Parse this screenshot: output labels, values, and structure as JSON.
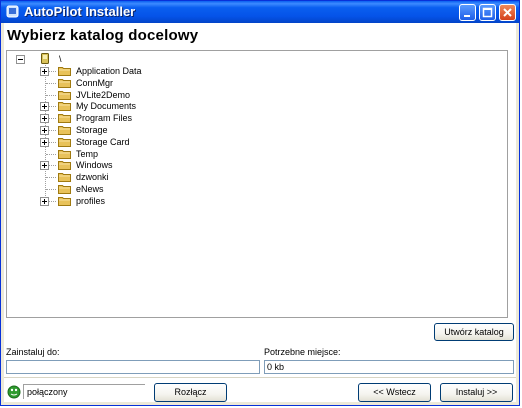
{
  "window": {
    "title": "AutoPilot Installer"
  },
  "heading": "Wybierz katalog docelowy",
  "tree": {
    "root": "\\",
    "items": [
      {
        "label": "Application Data",
        "expandable": true
      },
      {
        "label": "ConnMgr",
        "expandable": false
      },
      {
        "label": "JVLite2Demo",
        "expandable": false
      },
      {
        "label": "My Documents",
        "expandable": true
      },
      {
        "label": "Program Files",
        "expandable": true
      },
      {
        "label": "Storage",
        "expandable": true
      },
      {
        "label": "Storage Card",
        "expandable": true
      },
      {
        "label": "Temp",
        "expandable": false
      },
      {
        "label": "Windows",
        "expandable": true
      },
      {
        "label": "dzwonki",
        "expandable": false
      },
      {
        "label": "eNews",
        "expandable": false
      },
      {
        "label": "profiles",
        "expandable": true
      }
    ]
  },
  "buttons": {
    "create_folder": "Utwórz katalog",
    "disconnect": "Rozłącz",
    "back": "<< Wstecz",
    "install": "Instaluj >>"
  },
  "install_to": {
    "label": "Zainstaluj do:",
    "value": ""
  },
  "required_space": {
    "label": "Potrzebne miejsce:",
    "value": "0 kb"
  },
  "status": {
    "text": "połączony",
    "color": "#2e9b2e"
  },
  "colors": {
    "titlebar": "#0a5ff0",
    "close_button": "#d4411c",
    "folder": "#e8c25a"
  }
}
